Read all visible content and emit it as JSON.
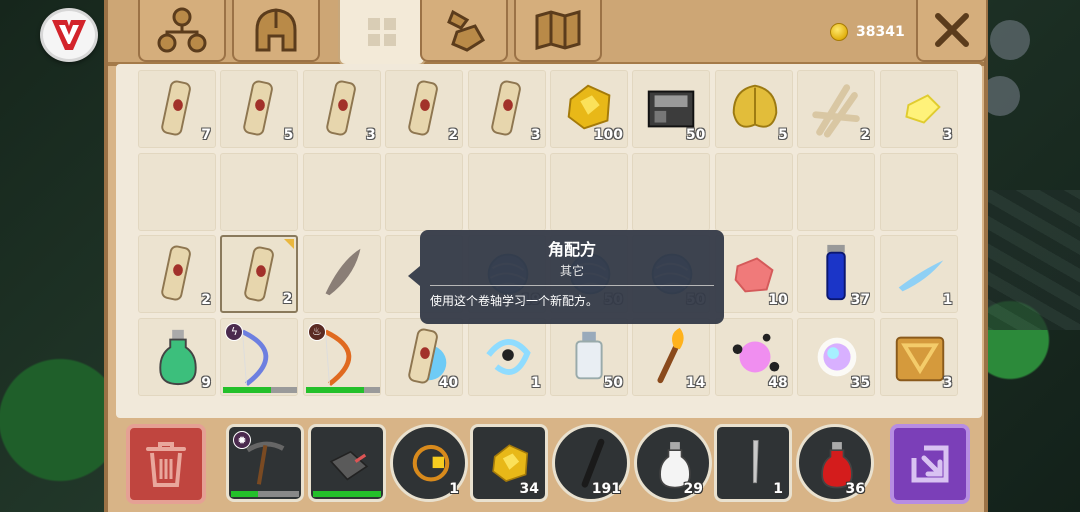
{
  "currency": {
    "gold": "38341"
  },
  "tabs": [
    {
      "id": "crafting",
      "icon": "skill-tree-icon",
      "active": false
    },
    {
      "id": "equipment",
      "icon": "helmet-icon",
      "active": false
    },
    {
      "id": "inventory",
      "icon": "grid-icon",
      "active": true
    },
    {
      "id": "materials",
      "icon": "ore-icon",
      "active": false
    },
    {
      "id": "map",
      "icon": "map-icon",
      "active": false
    }
  ],
  "inventory": {
    "rows": [
      [
        {
          "item": "recipe-scroll-icon",
          "count": "7"
        },
        {
          "item": "recipe-scroll-icon",
          "count": "5"
        },
        {
          "item": "recipe-scroll-icon",
          "count": "3"
        },
        {
          "item": "recipe-scroll-icon",
          "count": "2"
        },
        {
          "item": "recipe-scroll-icon",
          "count": "3"
        },
        {
          "item": "gold-ore-icon",
          "count": "100"
        },
        {
          "item": "iron-block-icon",
          "count": "50"
        },
        {
          "item": "gold-leaf-icon",
          "count": "5"
        },
        {
          "item": "bones-icon",
          "count": "2"
        },
        {
          "item": "yellow-crystal-icon",
          "count": "3"
        }
      ],
      [
        {
          "item": "",
          "count": ""
        },
        {
          "item": "",
          "count": ""
        },
        {
          "item": "",
          "count": ""
        },
        {
          "item": "",
          "count": ""
        },
        {
          "item": "",
          "count": ""
        },
        {
          "item": "",
          "count": ""
        },
        {
          "item": "",
          "count": ""
        },
        {
          "item": "",
          "count": ""
        },
        {
          "item": "",
          "count": ""
        },
        {
          "item": "",
          "count": ""
        }
      ],
      [
        {
          "item": "recipe-scroll-icon",
          "count": "2"
        },
        {
          "item": "recipe-scroll-icon",
          "count": "2",
          "selected": true
        },
        {
          "item": "dark-feather-icon",
          "count": ""
        },
        {
          "item": "",
          "count": ""
        },
        {
          "item": "blue-yarn-icon",
          "count": "19"
        },
        {
          "item": "blue-yarn-icon",
          "count": "50"
        },
        {
          "item": "blue-yarn-icon",
          "count": "50"
        },
        {
          "item": "pink-crystal-icon",
          "count": "10"
        },
        {
          "item": "blue-potion-icon",
          "count": "37"
        },
        {
          "item": "blue-feather-icon",
          "count": "1"
        }
      ],
      [
        {
          "item": "green-potion-icon",
          "count": "9"
        },
        {
          "item": "lightning-bow-icon",
          "count": "",
          "element": "lightning",
          "durability": 65
        },
        {
          "item": "fire-bow-icon",
          "count": "",
          "element": "fire",
          "durability": 78
        },
        {
          "item": "ice-scroll-icon",
          "count": "40"
        },
        {
          "item": "frost-swirl-icon",
          "count": "1"
        },
        {
          "item": "bottle-icon",
          "count": "50"
        },
        {
          "item": "torch-icon",
          "count": "14"
        },
        {
          "item": "pink-splash-icon",
          "count": "48"
        },
        {
          "item": "rainbow-orb-icon",
          "count": "35"
        },
        {
          "item": "treasure-crate-icon",
          "count": "3"
        }
      ]
    ]
  },
  "tooltip": {
    "title": "角配方",
    "category": "其它",
    "description": "使用这个卷轴学习一个新配方。"
  },
  "hotbar": [
    {
      "item": "pickaxe-icon",
      "count": "",
      "shape": "sq",
      "element": "lightning",
      "durability": 40
    },
    {
      "item": "gauntlet-icon",
      "count": "",
      "shape": "sq",
      "durability": 100
    },
    {
      "item": "fire-ring-icon",
      "count": "1",
      "shape": "round"
    },
    {
      "item": "gold-ore-icon",
      "count": "34",
      "shape": "sq"
    },
    {
      "item": "stick-icon",
      "count": "191",
      "shape": "round"
    },
    {
      "item": "white-potion-icon",
      "count": "29",
      "shape": "round"
    },
    {
      "item": "dagger-icon",
      "count": "1",
      "shape": "sq"
    },
    {
      "item": "red-potion-icon",
      "count": "36",
      "shape": "round"
    }
  ],
  "colors": {
    "panel": "#d8b487",
    "grid": "#f1e9da",
    "trash": "#c0453f",
    "swap": "#7b3fb8",
    "durability": "#24c02a"
  }
}
